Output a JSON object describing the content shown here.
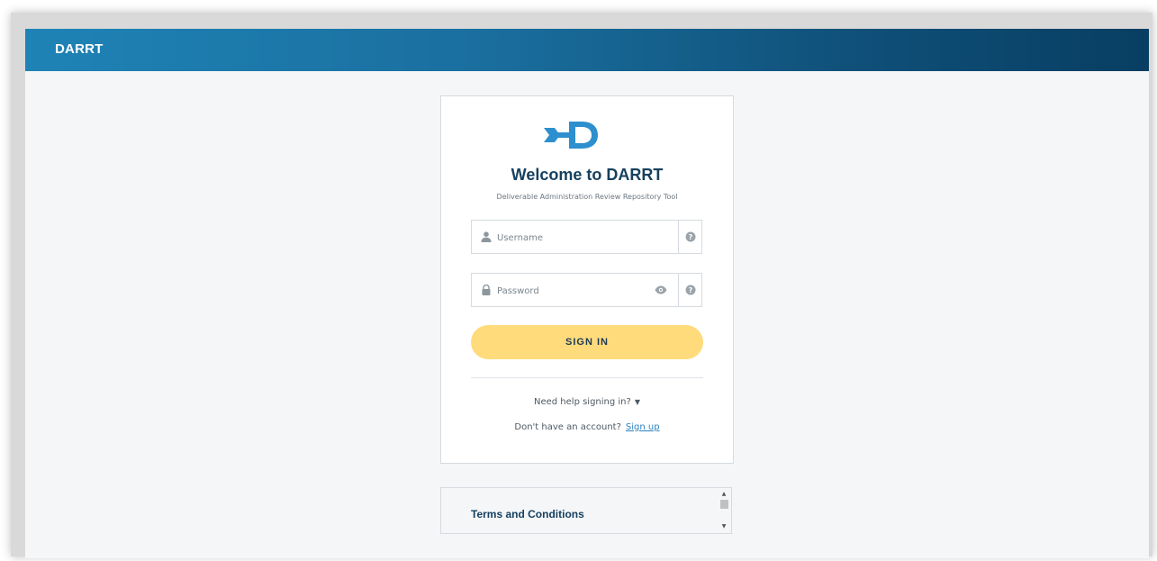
{
  "header": {
    "brand": "DARRT"
  },
  "login": {
    "title": "Welcome to DARRT",
    "subtitle": "Deliverable Administration Review Repository Tool",
    "username_placeholder": "Username",
    "password_placeholder": "Password",
    "signin_label": "SIGN IN",
    "help_text": "Need help signing in?",
    "no_account_text": "Don't have an account?",
    "signup_link": "Sign up"
  },
  "terms": {
    "heading": "Terms and Conditions"
  },
  "icons": {
    "logo": "darrt-logo",
    "user": "user-icon",
    "lock": "lock-icon",
    "eye": "eye-icon",
    "help": "help-icon",
    "caret": "caret-down-icon"
  },
  "colors": {
    "header_gradient_start": "#1f83b6",
    "header_gradient_end": "#083e62",
    "title": "#17405e",
    "signin_button": "#ffdb7c",
    "link": "#2c83c1",
    "logo": "#2d8fce"
  }
}
